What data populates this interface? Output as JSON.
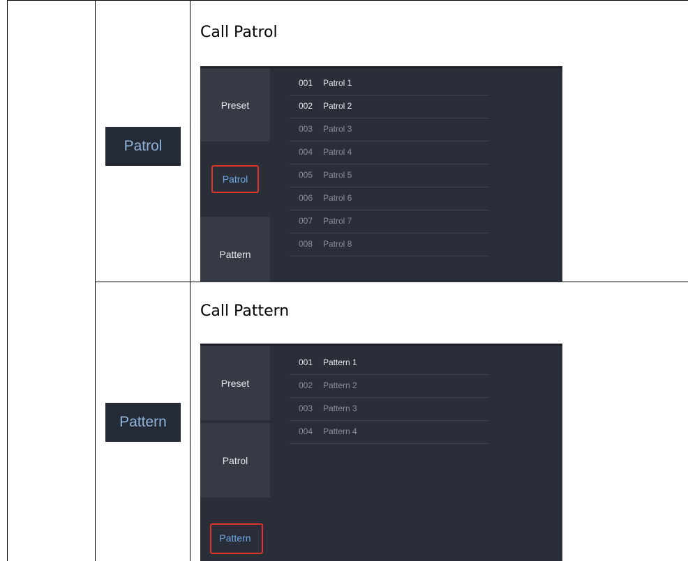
{
  "rows": [
    {
      "icon_label": "Patrol",
      "title": "Call Patrol",
      "tabs": [
        "Preset",
        "Patrol",
        "Pattern"
      ],
      "active_tab": "Patrol",
      "items": [
        {
          "num": "001",
          "name": "Patrol 1"
        },
        {
          "num": "002",
          "name": "Patrol 2"
        },
        {
          "num": "003",
          "name": "Patrol 3"
        },
        {
          "num": "004",
          "name": "Patrol 4"
        },
        {
          "num": "005",
          "name": "Patrol 5"
        },
        {
          "num": "006",
          "name": "Patrol 6"
        },
        {
          "num": "007",
          "name": "Patrol 7"
        },
        {
          "num": "008",
          "name": "Patrol 8"
        }
      ]
    },
    {
      "icon_label": "Pattern",
      "title": "Call Pattern",
      "tabs": [
        "Preset",
        "Patrol",
        "Pattern"
      ],
      "active_tab": "Pattern",
      "items": [
        {
          "num": "001",
          "name": "Pattern 1"
        },
        {
          "num": "002",
          "name": "Pattern 2"
        },
        {
          "num": "003",
          "name": "Pattern 3"
        },
        {
          "num": "004",
          "name": "Pattern 4"
        }
      ]
    }
  ],
  "colors": {
    "panel_bg": "#2a2e38",
    "tab_inactive_bg": "#363a45",
    "active_text": "#6fa8e8",
    "highlight_border": "#e0342b",
    "icon_bg": "#252b36",
    "icon_text": "#8fb3da"
  }
}
